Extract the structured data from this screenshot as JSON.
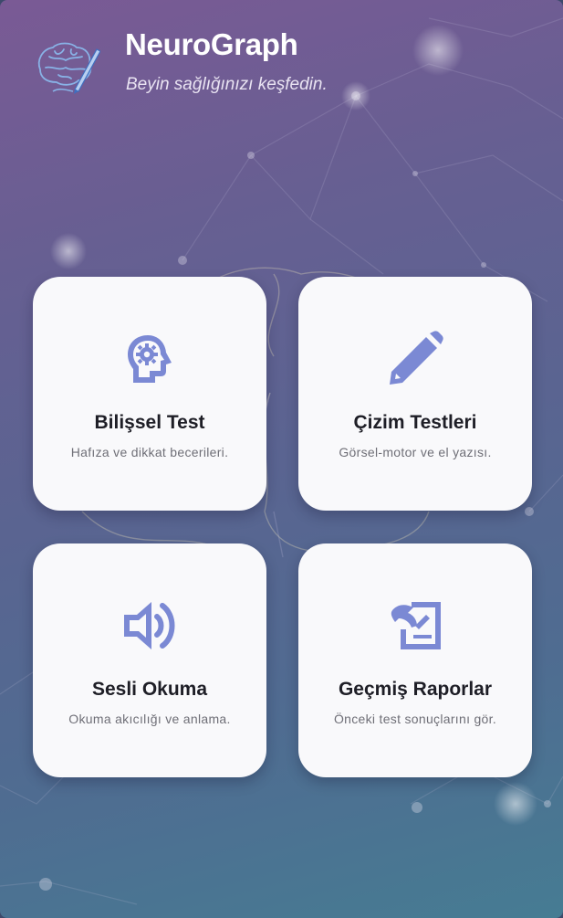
{
  "app": {
    "title": "NeuroGraph",
    "subtitle": "Beyin sağlığınızı keşfedin."
  },
  "cards": [
    {
      "title": "Bilişsel Test",
      "description": "Hafıza ve dikkat becerileri.",
      "icon": "head-gear-icon"
    },
    {
      "title": "Çizim Testleri",
      "description": "Görsel-motor ve el yazısı.",
      "icon": "pencil-icon"
    },
    {
      "title": "Sesli Okuma",
      "description": "Okuma akıcılığı ve anlama.",
      "icon": "speaker-icon"
    },
    {
      "title": "Geçmiş Raporlar",
      "description": "Önceki test sonuçlarını gör.",
      "icon": "report-icon"
    }
  ],
  "colors": {
    "accent": "#7b89d4",
    "card": "#f9f9fb",
    "gradient_top": "#7a5a95",
    "gradient_bottom": "#467c93"
  }
}
